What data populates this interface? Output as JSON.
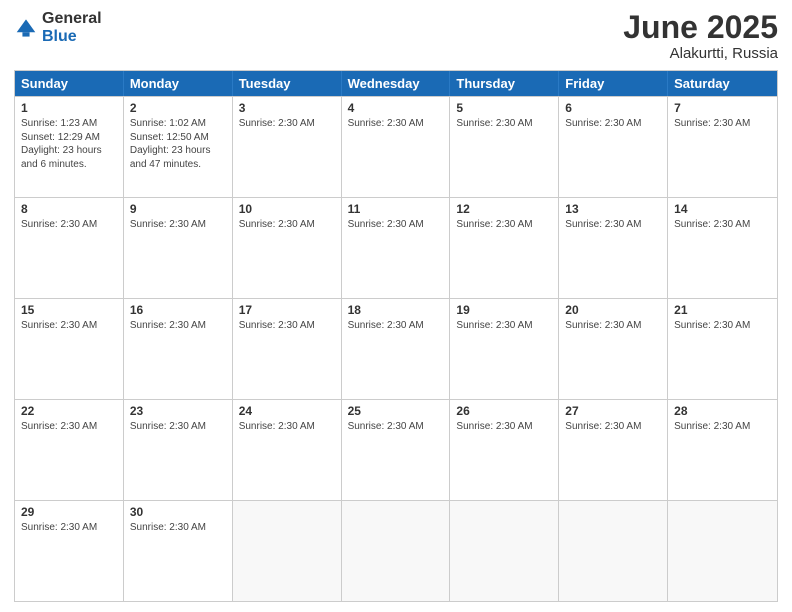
{
  "logo": {
    "line1": "General",
    "line2": "Blue"
  },
  "title": {
    "month": "June 2025",
    "location": "Alakurtti, Russia"
  },
  "header": {
    "days": [
      "Sunday",
      "Monday",
      "Tuesday",
      "Wednesday",
      "Thursday",
      "Friday",
      "Saturday"
    ]
  },
  "weeks": [
    [
      {
        "day": "1",
        "info": "Sunrise: 1:23 AM\nSunset: 12:29 AM\nDaylight: 23 hours and 6 minutes."
      },
      {
        "day": "2",
        "info": "Sunrise: 1:02 AM\nSunset: 12:50 AM\nDaylight: 23 hours and 47 minutes."
      },
      {
        "day": "3",
        "info": "Sunrise: 2:30 AM"
      },
      {
        "day": "4",
        "info": "Sunrise: 2:30 AM"
      },
      {
        "day": "5",
        "info": "Sunrise: 2:30 AM"
      },
      {
        "day": "6",
        "info": "Sunrise: 2:30 AM"
      },
      {
        "day": "7",
        "info": "Sunrise: 2:30 AM"
      }
    ],
    [
      {
        "day": "8",
        "info": "Sunrise: 2:30 AM"
      },
      {
        "day": "9",
        "info": "Sunrise: 2:30 AM"
      },
      {
        "day": "10",
        "info": "Sunrise: 2:30 AM"
      },
      {
        "day": "11",
        "info": "Sunrise: 2:30 AM"
      },
      {
        "day": "12",
        "info": "Sunrise: 2:30 AM"
      },
      {
        "day": "13",
        "info": "Sunrise: 2:30 AM"
      },
      {
        "day": "14",
        "info": "Sunrise: 2:30 AM"
      }
    ],
    [
      {
        "day": "15",
        "info": "Sunrise: 2:30 AM"
      },
      {
        "day": "16",
        "info": "Sunrise: 2:30 AM"
      },
      {
        "day": "17",
        "info": "Sunrise: 2:30 AM"
      },
      {
        "day": "18",
        "info": "Sunrise: 2:30 AM"
      },
      {
        "day": "19",
        "info": "Sunrise: 2:30 AM"
      },
      {
        "day": "20",
        "info": "Sunrise: 2:30 AM"
      },
      {
        "day": "21",
        "info": "Sunrise: 2:30 AM"
      }
    ],
    [
      {
        "day": "22",
        "info": "Sunrise: 2:30 AM"
      },
      {
        "day": "23",
        "info": "Sunrise: 2:30 AM"
      },
      {
        "day": "24",
        "info": "Sunrise: 2:30 AM"
      },
      {
        "day": "25",
        "info": "Sunrise: 2:30 AM"
      },
      {
        "day": "26",
        "info": "Sunrise: 2:30 AM"
      },
      {
        "day": "27",
        "info": "Sunrise: 2:30 AM"
      },
      {
        "day": "28",
        "info": "Sunrise: 2:30 AM"
      }
    ],
    [
      {
        "day": "29",
        "info": "Sunrise: 2:30 AM"
      },
      {
        "day": "30",
        "info": "Sunrise: 2:30 AM"
      },
      {
        "day": "",
        "info": ""
      },
      {
        "day": "",
        "info": ""
      },
      {
        "day": "",
        "info": ""
      },
      {
        "day": "",
        "info": ""
      },
      {
        "day": "",
        "info": ""
      }
    ]
  ]
}
